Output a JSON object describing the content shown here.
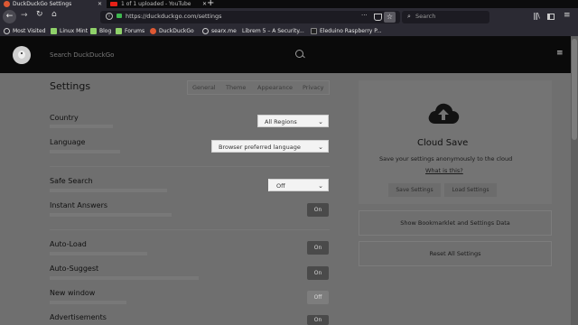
{
  "browser": {
    "tabs": [
      {
        "label": "DuckDuckGo Settings",
        "active": true
      },
      {
        "label": "1 of 1 uploaded - YouTube",
        "active": false
      }
    ],
    "new_tab": "+",
    "url": "https://duckduckgo.com/settings",
    "search_placeholder": "Search",
    "bookmarks": [
      {
        "label": "Most Visited",
        "icon": "gear-icon"
      },
      {
        "label": "Linux Mint",
        "icon": "mint-icon"
      },
      {
        "label": "Blog",
        "icon": "page-icon"
      },
      {
        "label": "Forums",
        "icon": "page-icon"
      },
      {
        "label": "DuckDuckGo",
        "icon": "duck-icon"
      },
      {
        "label": "searx.me",
        "icon": "searx-icon"
      },
      {
        "label": "Librem 5 – A Security...",
        "icon": "page-icon"
      },
      {
        "label": "Eleduino Raspberry P...",
        "icon": "page-icon"
      }
    ]
  },
  "header": {
    "search_placeholder": "Search DuckDuckGo"
  },
  "settings": {
    "title": "Settings",
    "tabs": [
      "General",
      "Theme",
      "Appearance",
      "Privacy"
    ],
    "country": {
      "label": "Country",
      "value": "All Regions"
    },
    "language": {
      "label": "Language",
      "value": "Browser preferred language"
    },
    "safe_search": {
      "label": "Safe Search",
      "value": "Off"
    },
    "instant_answers": {
      "label": "Instant Answers",
      "value": "On"
    },
    "auto_load": {
      "label": "Auto-Load",
      "value": "On"
    },
    "auto_suggest": {
      "label": "Auto-Suggest",
      "value": "On"
    },
    "new_window": {
      "label": "New window",
      "value": "Off"
    },
    "advertisements": {
      "label": "Advertisements",
      "value": "On"
    }
  },
  "cloud": {
    "title": "Cloud Save",
    "description": "Save your settings anonymously to the cloud",
    "link": "What is this?",
    "save_button": "Save Settings",
    "load_button": "Load Settings",
    "bookmarklet_button": "Show Bookmarklet and Settings Data",
    "reset_button": "Reset All Settings"
  }
}
